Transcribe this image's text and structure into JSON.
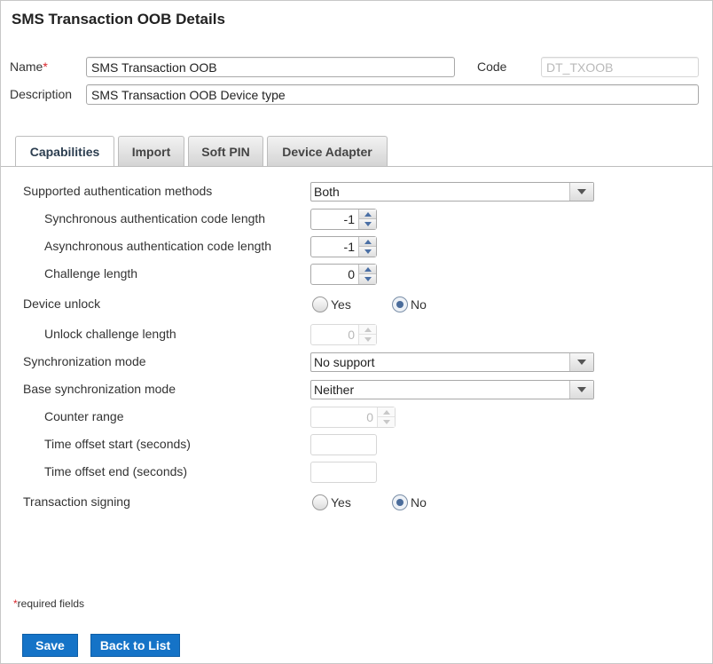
{
  "header": {
    "title": "SMS Transaction OOB Details"
  },
  "form": {
    "name_label": "Name",
    "required_marker": "*",
    "name_value": "SMS Transaction OOB",
    "code_label": "Code",
    "code_value": "DT_TXOOB",
    "description_label": "Description",
    "description_value": "SMS Transaction OOB Device type"
  },
  "tabs": [
    {
      "label": "Capabilities",
      "active": true
    },
    {
      "label": "Import",
      "active": false
    },
    {
      "label": "Soft PIN",
      "active": false
    },
    {
      "label": "Device Adapter",
      "active": false
    }
  ],
  "capabilities": {
    "auth_methods_label": "Supported authentication methods",
    "auth_methods_value": "Both",
    "sync_code_length_label": "Synchronous authentication code length",
    "sync_code_length_value": "-1",
    "async_code_length_label": "Asynchronous authentication code length",
    "async_code_length_value": "-1",
    "challenge_length_label": "Challenge length",
    "challenge_length_value": "0",
    "device_unlock_label": "Device unlock",
    "device_unlock_yes": "Yes",
    "device_unlock_no": "No",
    "device_unlock_selected": "No",
    "unlock_challenge_label": "Unlock challenge length",
    "unlock_challenge_value": "0",
    "sync_mode_label": "Synchronization mode",
    "sync_mode_value": "No support",
    "base_sync_mode_label": "Base synchronization mode",
    "base_sync_mode_value": "Neither",
    "counter_range_label": "Counter range",
    "counter_range_value": "0",
    "time_offset_start_label": "Time offset start (seconds)",
    "time_offset_start_value": "",
    "time_offset_end_label": "Time offset end (seconds)",
    "time_offset_end_value": "",
    "transaction_signing_label": "Transaction signing",
    "transaction_signing_yes": "Yes",
    "transaction_signing_no": "No",
    "transaction_signing_selected": "No"
  },
  "footer": {
    "required_note_star": "*",
    "required_note": "required fields",
    "save_label": "Save",
    "back_label": "Back to List"
  },
  "colors": {
    "primary_button": "#1573c7",
    "required_star": "#d9262c"
  }
}
